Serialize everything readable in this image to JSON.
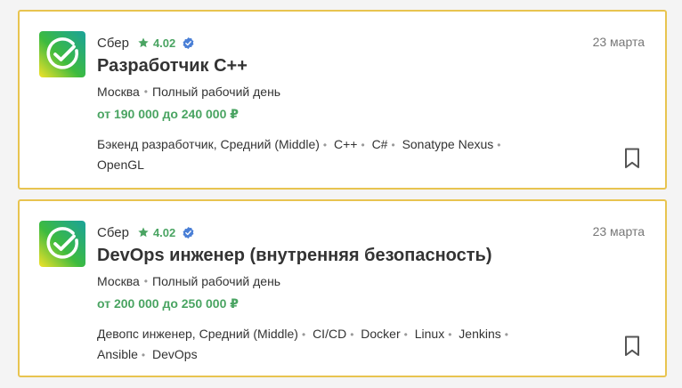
{
  "colors": {
    "border": "#e8c450",
    "salary": "#4aa462",
    "rating": "#4aa462",
    "verified": "#4a7fd6",
    "text": "#333333",
    "muted": "#777777"
  },
  "vacancies": [
    {
      "company": "Сбер",
      "rating": "4.02",
      "date": "23 марта",
      "title": "Разработчик C++",
      "location": "Москва",
      "schedule": "Полный рабочий день",
      "salary": "от 190 000 до 240 000 ₽",
      "tags": [
        "Бэкенд разработчик, Средний (Middle)",
        "C++",
        "C#",
        "Sonatype Nexus",
        "OpenGL"
      ],
      "logo_icon": "sber-logo-icon",
      "bookmark_icon": "bookmark-icon"
    },
    {
      "company": "Сбер",
      "rating": "4.02",
      "date": "23 марта",
      "title": "DevOps инженер (внутренняя безопасность)",
      "location": "Москва",
      "schedule": "Полный рабочий день",
      "salary": "от 200 000 до 250 000 ₽",
      "tags": [
        "Девопс инженер, Средний (Middle)",
        "CI/CD",
        "Docker",
        "Linux",
        "Jenkins",
        "Ansible",
        "DevOps"
      ],
      "logo_icon": "sber-logo-icon",
      "bookmark_icon": "bookmark-icon"
    }
  ]
}
